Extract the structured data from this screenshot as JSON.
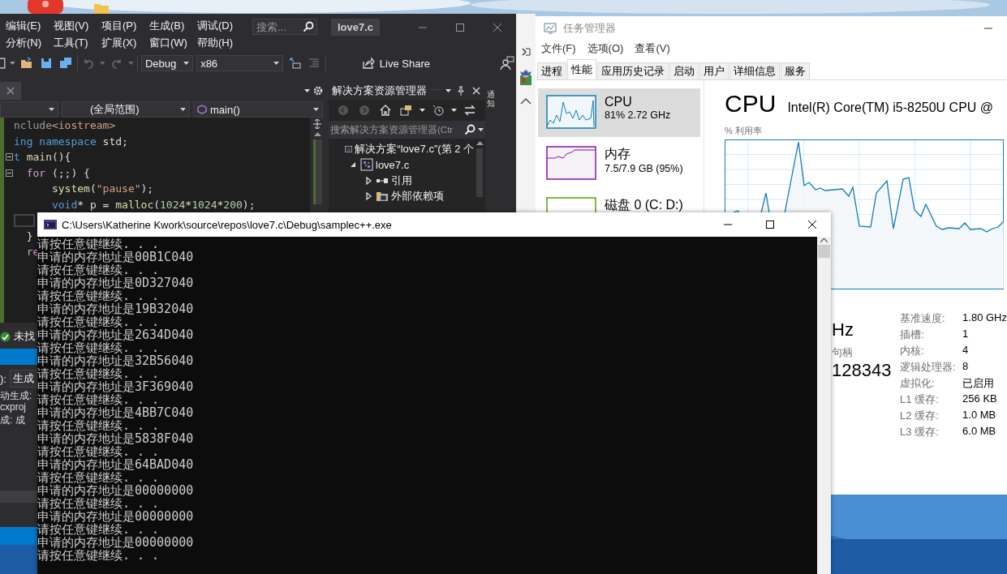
{
  "visual_studio": {
    "menu_rows": [
      [
        "编辑(E)",
        "视图(V)",
        "项目(P)",
        "生成(B)",
        "调试(D)"
      ],
      [
        "分析(N)",
        "工具(T)",
        "扩展(X)",
        "窗口(W)",
        "帮助(H)"
      ]
    ],
    "search": {
      "placeholder": "搜索..."
    },
    "title": "love7.c",
    "toolbar": {
      "configuration": "Debug",
      "platform": "x86",
      "live_share": "Live Share"
    },
    "notification_tab": "通知",
    "editor": {
      "scope": "(全局范围)",
      "member": "main()",
      "code_lines": [
        {
          "fold": false,
          "current": false,
          "segments": [
            {
              "kind": "preproc",
              "text": "nclude"
            },
            {
              "kind": "string",
              "text": "<iostream>"
            }
          ]
        },
        {
          "fold": false,
          "current": false,
          "segments": [
            {
              "kind": "keyword",
              "text": "ing"
            },
            {
              "kind": "keyword",
              "text": " namespace"
            },
            {
              "kind": "plain",
              "text": " std;"
            }
          ]
        },
        {
          "fold": true,
          "current": false,
          "segments": [
            {
              "kind": "keyword",
              "text": "t"
            },
            {
              "kind": "function",
              "text": " main"
            },
            {
              "kind": "plain",
              "text": "(){"
            }
          ]
        },
        {
          "fold": true,
          "current": false,
          "segments": [
            {
              "kind": "control",
              "text": "  for"
            },
            {
              "kind": "plain",
              "text": " (;;) {"
            }
          ]
        },
        {
          "fold": false,
          "current": false,
          "segments": [
            {
              "kind": "function",
              "text": "      system"
            },
            {
              "kind": "plain",
              "text": "("
            },
            {
              "kind": "string",
              "text": "\"pause\""
            },
            {
              "kind": "plain",
              "text": ");"
            }
          ]
        },
        {
          "fold": false,
          "current": false,
          "segments": [
            {
              "kind": "keyword",
              "text": "      void"
            },
            {
              "kind": "plain",
              "text": "* p = "
            },
            {
              "kind": "function",
              "text": "malloc"
            },
            {
              "kind": "plain",
              "text": "("
            },
            {
              "kind": "number",
              "text": "1024"
            },
            {
              "kind": "plain",
              "text": "*"
            },
            {
              "kind": "number",
              "text": "1024"
            },
            {
              "kind": "plain",
              "text": "*"
            },
            {
              "kind": "number",
              "text": "200"
            },
            {
              "kind": "plain",
              "text": ");"
            }
          ]
        },
        {
          "fold": false,
          "current": true
        },
        {
          "fold": false,
          "current": false,
          "segments": [
            {
              "kind": "plain",
              "text": "  }"
            }
          ]
        },
        {
          "fold": false,
          "current": false,
          "segments": [
            {
              "kind": "control",
              "text": "  re"
            }
          ]
        }
      ]
    },
    "solution_explorer": {
      "title": "解决方案资源管理器",
      "search": {
        "placeholder": "搜索解决方案资源管理器(Ctr"
      },
      "tree": [
        {
          "label": "解决方案“love7.c”(第 2 个",
          "kind": "solution",
          "children": [
            {
              "label": "love7.c",
              "kind": "project",
              "expanded": true,
              "children": [
                {
                  "label": "引用",
                  "kind": "references",
                  "expanded": false
                },
                {
                  "label": "外部依赖项",
                  "kind": "dependencies",
                  "expanded": false
                }
              ]
            }
          ]
        }
      ]
    },
    "error_status": "未找",
    "output": {
      "source_label": "):",
      "source": "生成",
      "lines": [
        "动生成:",
        "cxproj",
        "成: 成"
      ]
    }
  },
  "task_manager": {
    "title": "任务管理器",
    "menu": [
      "文件(F)",
      "选项(O)",
      "查看(V)"
    ],
    "tabs": [
      {
        "label": "进程",
        "selected": false
      },
      {
        "label": "性能",
        "selected": true
      },
      {
        "label": "应用历史记录",
        "selected": false
      },
      {
        "label": "启动",
        "selected": false
      },
      {
        "label": "用户",
        "selected": false
      },
      {
        "label": "详细信息",
        "selected": false
      },
      {
        "label": "服务",
        "selected": false
      }
    ],
    "resources": [
      {
        "name": "CPU",
        "detail": "81% 2.72 GHz",
        "kind": "cpu",
        "selected": true
      },
      {
        "name": "内存",
        "detail": "7.5/7.9 GB (95%)",
        "kind": "memory",
        "selected": false
      },
      {
        "name": "磁盘 0 (C: D:)",
        "kind": "disk",
        "selected": false
      }
    ],
    "heading": "CPU",
    "processor": "Intel(R) Core(TM) i5-8250U CPU @",
    "chart_label": "% 利用率",
    "partial_stats": [
      {
        "kind": "value",
        "text": "Hz"
      },
      {
        "kind": "label",
        "text": "句柄"
      },
      {
        "kind": "value",
        "text": "128343"
      }
    ],
    "specs": [
      {
        "label": "基准速度:",
        "value": "1.80 GHz"
      },
      {
        "label": "插槽:",
        "value": "1"
      },
      {
        "label": "内核:",
        "value": "4"
      },
      {
        "label": "逻辑处理器:",
        "value": "8"
      },
      {
        "label": "虚拟化:",
        "value": "已启用"
      },
      {
        "label": "L1 缓存:",
        "value": "256 KB"
      },
      {
        "label": "L2 缓存:",
        "value": "1.0 MB"
      },
      {
        "label": "L3 缓存:",
        "value": "6.0 MB"
      }
    ]
  },
  "console": {
    "title": "C:\\Users\\Katherine Kwork\\source\\repos\\love7.c\\Debug\\samplec++.exe",
    "lines": [
      "请按任意键继续. . .",
      "申请的内存地址是00B1C040",
      "请按任意键继续. . .",
      "申请的内存地址是0D327040",
      "请按任意键继续. . .",
      "申请的内存地址是19B32040",
      "请按任意键继续. . .",
      "申请的内存地址是2634D040",
      "请按任意键继续. . .",
      "申请的内存地址是32B56040",
      "请按任意键继续. . .",
      "申请的内存地址是3F369040",
      "请按任意键继续. . .",
      "申请的内存地址是4BB7C040",
      "请按任意键继续. . .",
      "申请的内存地址是5838F040",
      "请按任意键继续. . .",
      "申请的内存地址是64BAD040",
      "请按任意键继续. . .",
      "申请的内存地址是00000000",
      "请按任意键继续. . .",
      "申请的内存地址是00000000",
      "请按任意键继续. . .",
      "申请的内存地址是00000000",
      "请按任意键继续. . ."
    ]
  }
}
